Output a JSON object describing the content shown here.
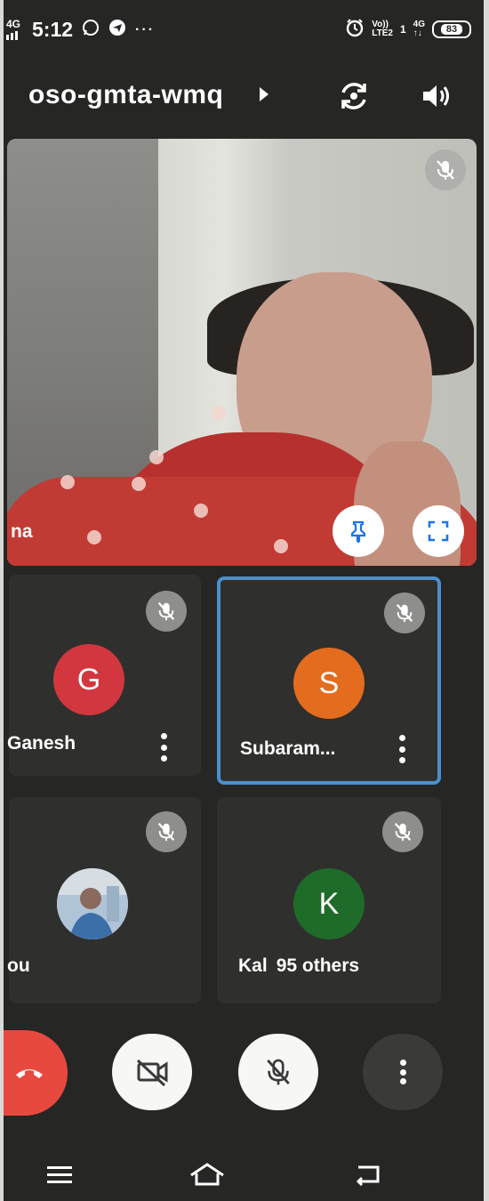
{
  "status_bar": {
    "network_left": "4G",
    "time": "5:12",
    "more": "···",
    "volte_top": "Vo))",
    "volte_bottom": "LTE2",
    "sim_num": "1",
    "net_top": "4G",
    "net_bottom": "↑↓",
    "battery": "83"
  },
  "top_bar": {
    "meeting_code": "oso-gmta-wmq"
  },
  "main_video": {
    "participant_name_partial": "na"
  },
  "tiles": [
    {
      "name": "Ganesh",
      "displayed_name": "Ganesh",
      "initial": "G",
      "color": "#d2373f"
    },
    {
      "name": "Subaram...",
      "displayed_name": "Subaram...",
      "initial": "S",
      "color": "#e46c1e"
    },
    {
      "name": "ou",
      "displayed_name": "ou",
      "initial": "",
      "color": "#cfd8dc"
    },
    {
      "name": "Kal",
      "displayed_name": "Kal  95 others",
      "others_label": "95 others",
      "initial": "K",
      "color": "#1e6b2a"
    }
  ],
  "colors": {
    "accent_blue": "#4a90d0",
    "end_call_red": "#e8493f",
    "background": "#262624"
  },
  "icons": {
    "camera_switch": "camera-switch-icon",
    "speaker": "speaker-icon",
    "mic_off": "mic-off-icon",
    "camera_off": "camera-off-icon",
    "pin": "pin-icon",
    "fullscreen": "fullscreen-icon",
    "end_call": "end-call-icon",
    "more": "more-vertical-icon"
  }
}
